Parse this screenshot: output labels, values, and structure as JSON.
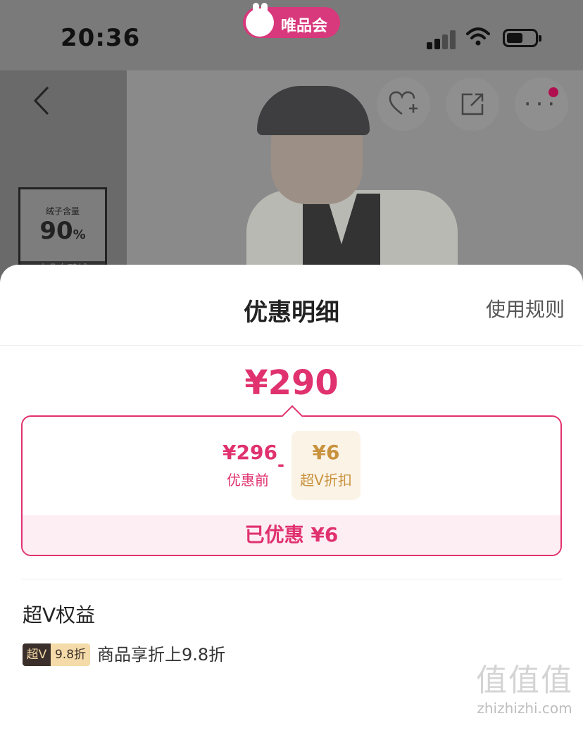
{
  "status_bar": {
    "time": "20:36",
    "app_name": "唯品会"
  },
  "product_page": {
    "back_icon": "chevron-left-icon",
    "actions": [
      "heart-plus-icon",
      "share-icon",
      "more-icon"
    ],
    "badge": {
      "small": "绒子含量",
      "big": "90",
      "unit": "%",
      "bottom": "大朵白鸭绒"
    }
  },
  "sheet": {
    "title": "优惠明细",
    "rules_link": "使用规则",
    "final_price": "¥290",
    "breakdown": {
      "before_amount": "¥296",
      "before_label": "优惠前",
      "minus": "-",
      "discount_amount": "¥6",
      "discount_label": "超V折扣",
      "saved_text": "已优惠 ¥6"
    },
    "rights": {
      "title": "超V权益",
      "chip_left": "超V",
      "chip_right": "9.8折",
      "description": "商品享折上9.8折"
    }
  },
  "watermark": {
    "glyphs": "值值值",
    "url": "zhizhizhi.com"
  },
  "colors": {
    "accent": "#e0326f",
    "gold": "#c9923e",
    "app_pink": "#d8387c"
  }
}
